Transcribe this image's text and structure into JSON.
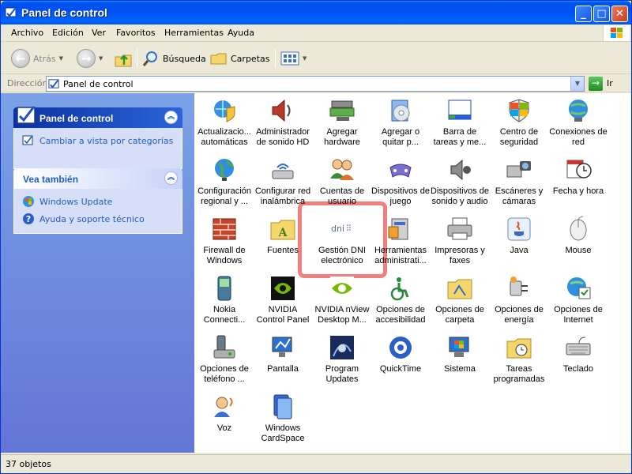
{
  "window": {
    "title": "Panel de control"
  },
  "menu": [
    "Archivo",
    "Edición",
    "Ver",
    "Favoritos",
    "Herramientas",
    "Ayuda"
  ],
  "toolbar": {
    "back_label": "Atrás",
    "search_label": "Búsqueda",
    "folders_label": "Carpetas"
  },
  "address": {
    "label": "Dirección",
    "value": "Panel de control",
    "go_label": "Ir"
  },
  "sidebar": {
    "panel": {
      "title": "Panel de control",
      "link": "Cambiar a vista por categorías"
    },
    "see_also": {
      "title": "Vea también",
      "links": [
        "Windows Update",
        "Ayuda y soporte técnico"
      ]
    }
  },
  "items": [
    {
      "label": "Actualizacio... automáticas",
      "icon": "globe-shield-icon"
    },
    {
      "label": "Administrador de sonido HD",
      "icon": "speaker-icon"
    },
    {
      "label": "Agregar hardware",
      "icon": "hardware-icon"
    },
    {
      "label": "Agregar o quitar p...",
      "icon": "cd-box-icon"
    },
    {
      "label": "Barra de tareas y me...",
      "icon": "taskbar-icon"
    },
    {
      "label": "Centro de seguridad",
      "icon": "shield-icon"
    },
    {
      "label": "Conexiones de red",
      "icon": "network-globe-icon"
    },
    {
      "label": "Configuración regional y ...",
      "icon": "globe-icon"
    },
    {
      "label": "Configurar red inalámbrica",
      "icon": "wireless-icon"
    },
    {
      "label": "Cuentas de usuario",
      "icon": "users-icon"
    },
    {
      "label": "Dispositivos de juego",
      "icon": "gamepad-icon"
    },
    {
      "label": "Dispositivos de sonido y audio",
      "icon": "audio-icon"
    },
    {
      "label": "Escáneres y cámaras",
      "icon": "scanner-icon"
    },
    {
      "label": "Fecha y hora",
      "icon": "calendar-clock-icon"
    },
    {
      "label": "Firewall de Windows",
      "icon": "firewall-icon"
    },
    {
      "label": "Fuentes",
      "icon": "fonts-folder-icon"
    },
    {
      "label": "Gestión DNI electrónico",
      "icon": "dni-icon",
      "icon_text": "dni"
    },
    {
      "label": "Herramientas administrati...",
      "icon": "admin-tools-icon"
    },
    {
      "label": "Impresoras y faxes",
      "icon": "printer-icon"
    },
    {
      "label": "Java",
      "icon": "java-icon"
    },
    {
      "label": "Mouse",
      "icon": "mouse-icon"
    },
    {
      "label": "Nokia Connecti...",
      "icon": "phone-icon"
    },
    {
      "label": "NVIDIA Control Panel",
      "icon": "nvidia-icon"
    },
    {
      "label": "NVIDIA nView Desktop M...",
      "icon": "nvidia-nview-icon"
    },
    {
      "label": "Opciones de accesibilidad",
      "icon": "accessibility-icon"
    },
    {
      "label": "Opciones de carpeta",
      "icon": "folder-options-icon"
    },
    {
      "label": "Opciones de energía",
      "icon": "power-icon"
    },
    {
      "label": "Opciones de Internet",
      "icon": "internet-options-icon"
    },
    {
      "label": "Opciones de teléfono ...",
      "icon": "telephone-modem-icon"
    },
    {
      "label": "Pantalla",
      "icon": "display-icon"
    },
    {
      "label": "Program Updates",
      "icon": "program-updates-icon"
    },
    {
      "label": "QuickTime",
      "icon": "quicktime-icon"
    },
    {
      "label": "Sistema",
      "icon": "system-icon"
    },
    {
      "label": "Tareas programadas",
      "icon": "scheduled-tasks-icon"
    },
    {
      "label": "Teclado",
      "icon": "keyboard-icon"
    },
    {
      "label": "Voz",
      "icon": "speech-icon"
    },
    {
      "label": "Windows CardSpace",
      "icon": "cardspace-icon"
    }
  ],
  "status": {
    "text": "37 objetos"
  }
}
